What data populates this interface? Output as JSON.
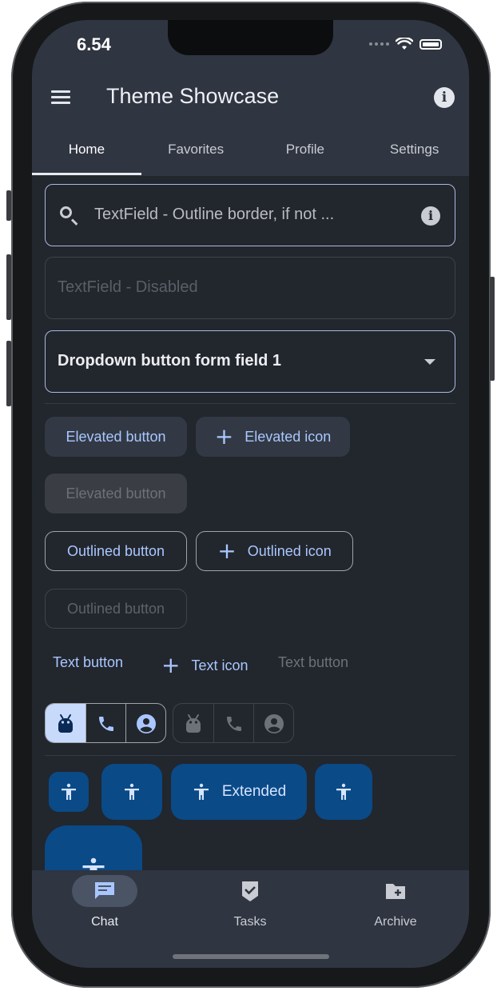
{
  "status": {
    "time": "6.54"
  },
  "appbar": {
    "title": "Theme Showcase"
  },
  "tabs": [
    "Home",
    "Favorites",
    "Profile",
    "Settings"
  ],
  "fields": {
    "search_text": "TextField - Outline border, if not ...",
    "disabled_text": "TextField - Disabled",
    "dropdown_value": "Dropdown button form field 1"
  },
  "buttons": {
    "elevated": "Elevated button",
    "elevated_icon": "Elevated icon",
    "elevated_disabled": "Elevated button",
    "outlined": "Outlined button",
    "outlined_icon": "Outlined icon",
    "outlined_disabled": "Outlined button",
    "text": "Text button",
    "text_icon": "Text icon",
    "text_disabled": "Text button"
  },
  "fab": {
    "extended_label": "Extended"
  },
  "bottom_nav": [
    {
      "label": "Chat",
      "icon": "chat-icon"
    },
    {
      "label": "Tasks",
      "icon": "task-check-icon"
    },
    {
      "label": "Archive",
      "icon": "folder-add-icon"
    }
  ],
  "colors": {
    "accent": "#a9c7ff",
    "fab": "#0a4a87",
    "appbar": "#2f3541",
    "background": "#22262d"
  }
}
